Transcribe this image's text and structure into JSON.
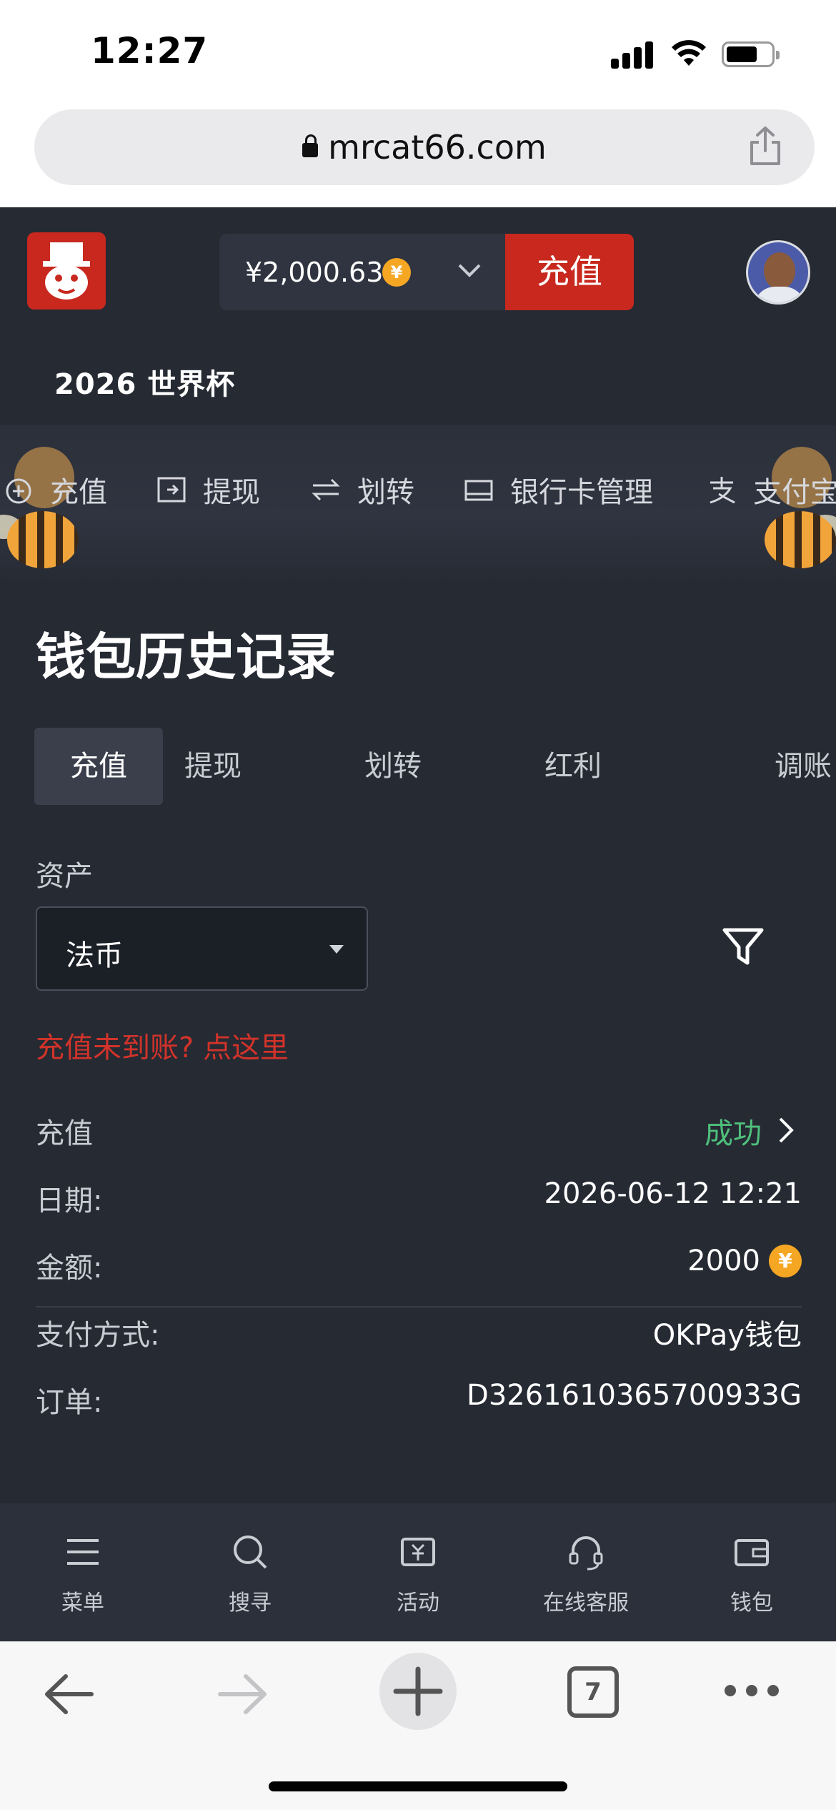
{
  "status_bar": {
    "time": "12:27"
  },
  "browser": {
    "url": "mrcat66.com",
    "tab_count": "7"
  },
  "header": {
    "balance": "¥2,000.63",
    "currency_symbol": "¥",
    "deposit_label": "充值",
    "promo_label": "2026 世界杯"
  },
  "quick_nav": [
    {
      "label": "充值",
      "icon": "deposit-icon"
    },
    {
      "label": "提现",
      "icon": "withdraw-icon"
    },
    {
      "label": "划转",
      "icon": "transfer-icon"
    },
    {
      "label": "银行卡管理",
      "icon": "bank-card-icon"
    },
    {
      "label": "支付宝",
      "icon": "alipay-icon"
    }
  ],
  "page": {
    "title": "钱包历史记录",
    "tabs": [
      "充值",
      "提现",
      "划转",
      "红利",
      "调账"
    ],
    "active_tab": "充值",
    "asset_label": "资产",
    "asset_value": "法币",
    "help_link": "充值未到账? 点这里"
  },
  "record": {
    "type": "充值",
    "status": "成功",
    "date_label": "日期:",
    "date_value": "2026-06-12 12:21",
    "amount_label": "金额:",
    "amount_value": "2000",
    "method_label": "支付方式:",
    "method_value": "OKPay钱包",
    "order_label": "订单:",
    "order_value": "D3261610365700933G"
  },
  "bottom_nav": [
    {
      "label": "菜单",
      "icon": "menu-icon"
    },
    {
      "label": "搜寻",
      "icon": "search-icon"
    },
    {
      "label": "活动",
      "icon": "promo-ticket-icon"
    },
    {
      "label": "在线客服",
      "icon": "headset-icon"
    },
    {
      "label": "钱包",
      "icon": "wallet-icon"
    }
  ],
  "colors": {
    "brand_red": "#c8281e",
    "background": "#252a33",
    "success_green": "#4fbf7c",
    "coin_gold": "#f5a623"
  }
}
